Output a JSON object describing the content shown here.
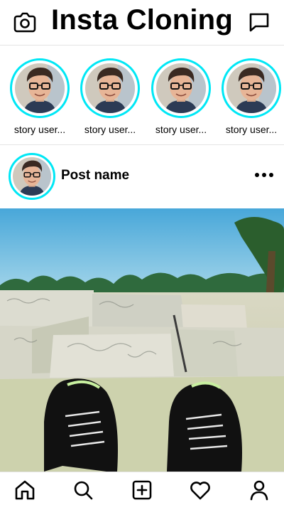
{
  "header": {
    "title": "Insta Cloning",
    "camera_icon": "camera-icon",
    "messages_icon": "message-square-icon"
  },
  "stories": [
    {
      "username": "story user..."
    },
    {
      "username": "story user..."
    },
    {
      "username": "story user..."
    },
    {
      "username": "story user..."
    }
  ],
  "post": {
    "name": "Post name",
    "more_icon": "more-horizontal-icon"
  },
  "nav": {
    "items": [
      "home-icon",
      "search-icon",
      "add-post-icon",
      "heart-icon",
      "profile-icon"
    ]
  },
  "colors": {
    "story_ring": "#00e7f5",
    "text": "#000000",
    "divider": "#e4e4e4"
  }
}
